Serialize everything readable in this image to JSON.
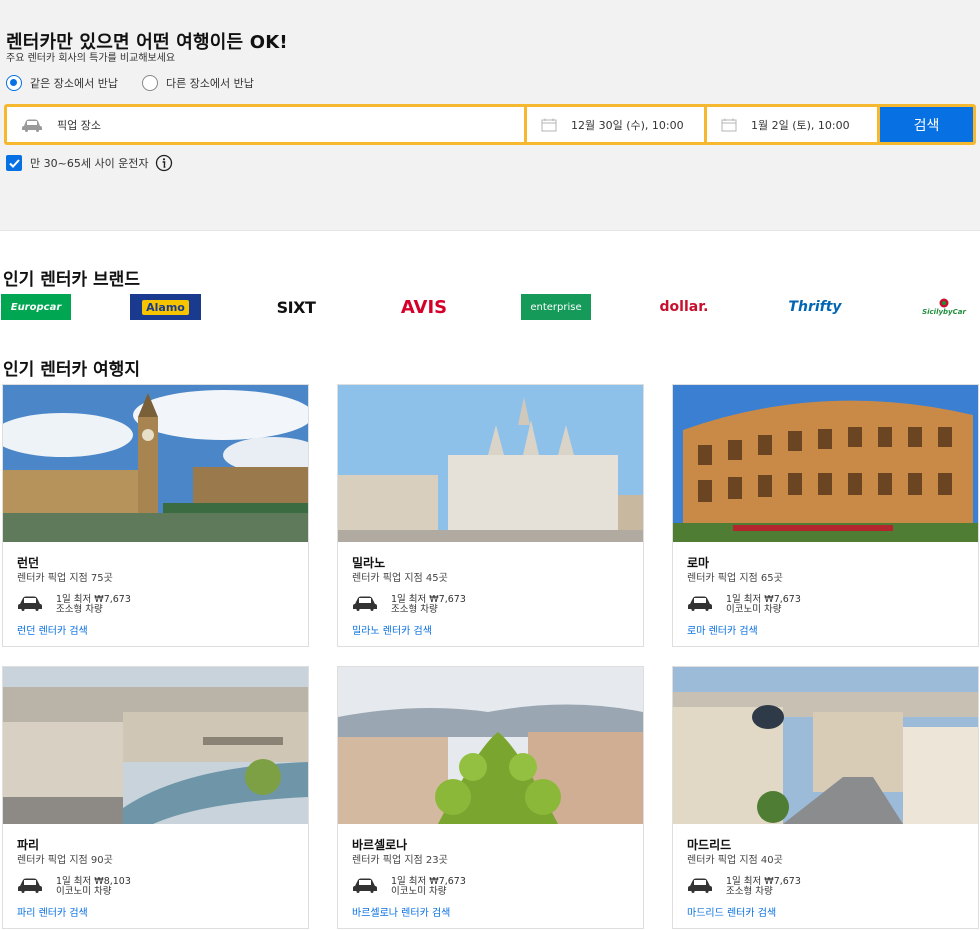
{
  "hero": {
    "title": "렌터카만 있으면 어떤 여행이든 OK!",
    "subtitle": "주요 렌터카 회사의 특가를 비교해보세요",
    "radio_same": "같은 장소에서 반납",
    "radio_diff": "다른 장소에서 반납",
    "pickup_placeholder": "픽업 장소",
    "date_pickup": "12월 30일 (수), 10:00",
    "date_return": "1월 2일 (토), 10:00",
    "search_label": "검색",
    "driver_age": "만 30~65세 사이 운전자"
  },
  "brands": {
    "title": "인기 렌터카 브랜드",
    "items": [
      {
        "name": "Europcar",
        "color": "#00a651"
      },
      {
        "name": "Alamo",
        "color": "#1a3a8f"
      },
      {
        "name": "SIXT",
        "color": "#111111"
      },
      {
        "name": "AVIS",
        "color": "#d4002a"
      },
      {
        "name": "enterprise",
        "color": "#169a5a"
      },
      {
        "name": "dollar.",
        "color": "#c8102e"
      },
      {
        "name": "Thrifty",
        "color": "#0066b3"
      },
      {
        "name": "SicilybyCar",
        "color": "#1f8f3a"
      }
    ]
  },
  "destinations": {
    "title": "인기 렌터카 여행지",
    "cards": [
      {
        "city": "런던",
        "branches": "렌터카 픽업 지점 75곳",
        "price": "1일 최저 ₩7,673",
        "car_class": "조소형 차량",
        "link": "런던 렌터카 검색"
      },
      {
        "city": "밀라노",
        "branches": "렌터카 픽업 지점 45곳",
        "price": "1일 최저 ₩7,673",
        "car_class": "조소형 차량",
        "link": "밀라노 렌터카 검색"
      },
      {
        "city": "로마",
        "branches": "렌터카 픽업 지점 65곳",
        "price": "1일 최저 ₩7,673",
        "car_class": "이코노미 차량",
        "link": "로마 렌터카 검색"
      },
      {
        "city": "파리",
        "branches": "렌터카 픽업 지점 90곳",
        "price": "1일 최저 ₩8,103",
        "car_class": "이코노미 차량",
        "link": "파리 렌터카 검색"
      },
      {
        "city": "바르셀로나",
        "branches": "렌터카 픽업 지점 23곳",
        "price": "1일 최저 ₩7,673",
        "car_class": "이코노미 차량",
        "link": "바르셀로나 렌터카 검색"
      },
      {
        "city": "마드리드",
        "branches": "렌터카 픽업 지점 40곳",
        "price": "1일 최저 ₩7,673",
        "car_class": "조소형 차량",
        "link": "마드리드 렌터카 검색"
      }
    ]
  },
  "colors": {
    "accent": "#0770e3",
    "search_border": "#f5b82e"
  }
}
